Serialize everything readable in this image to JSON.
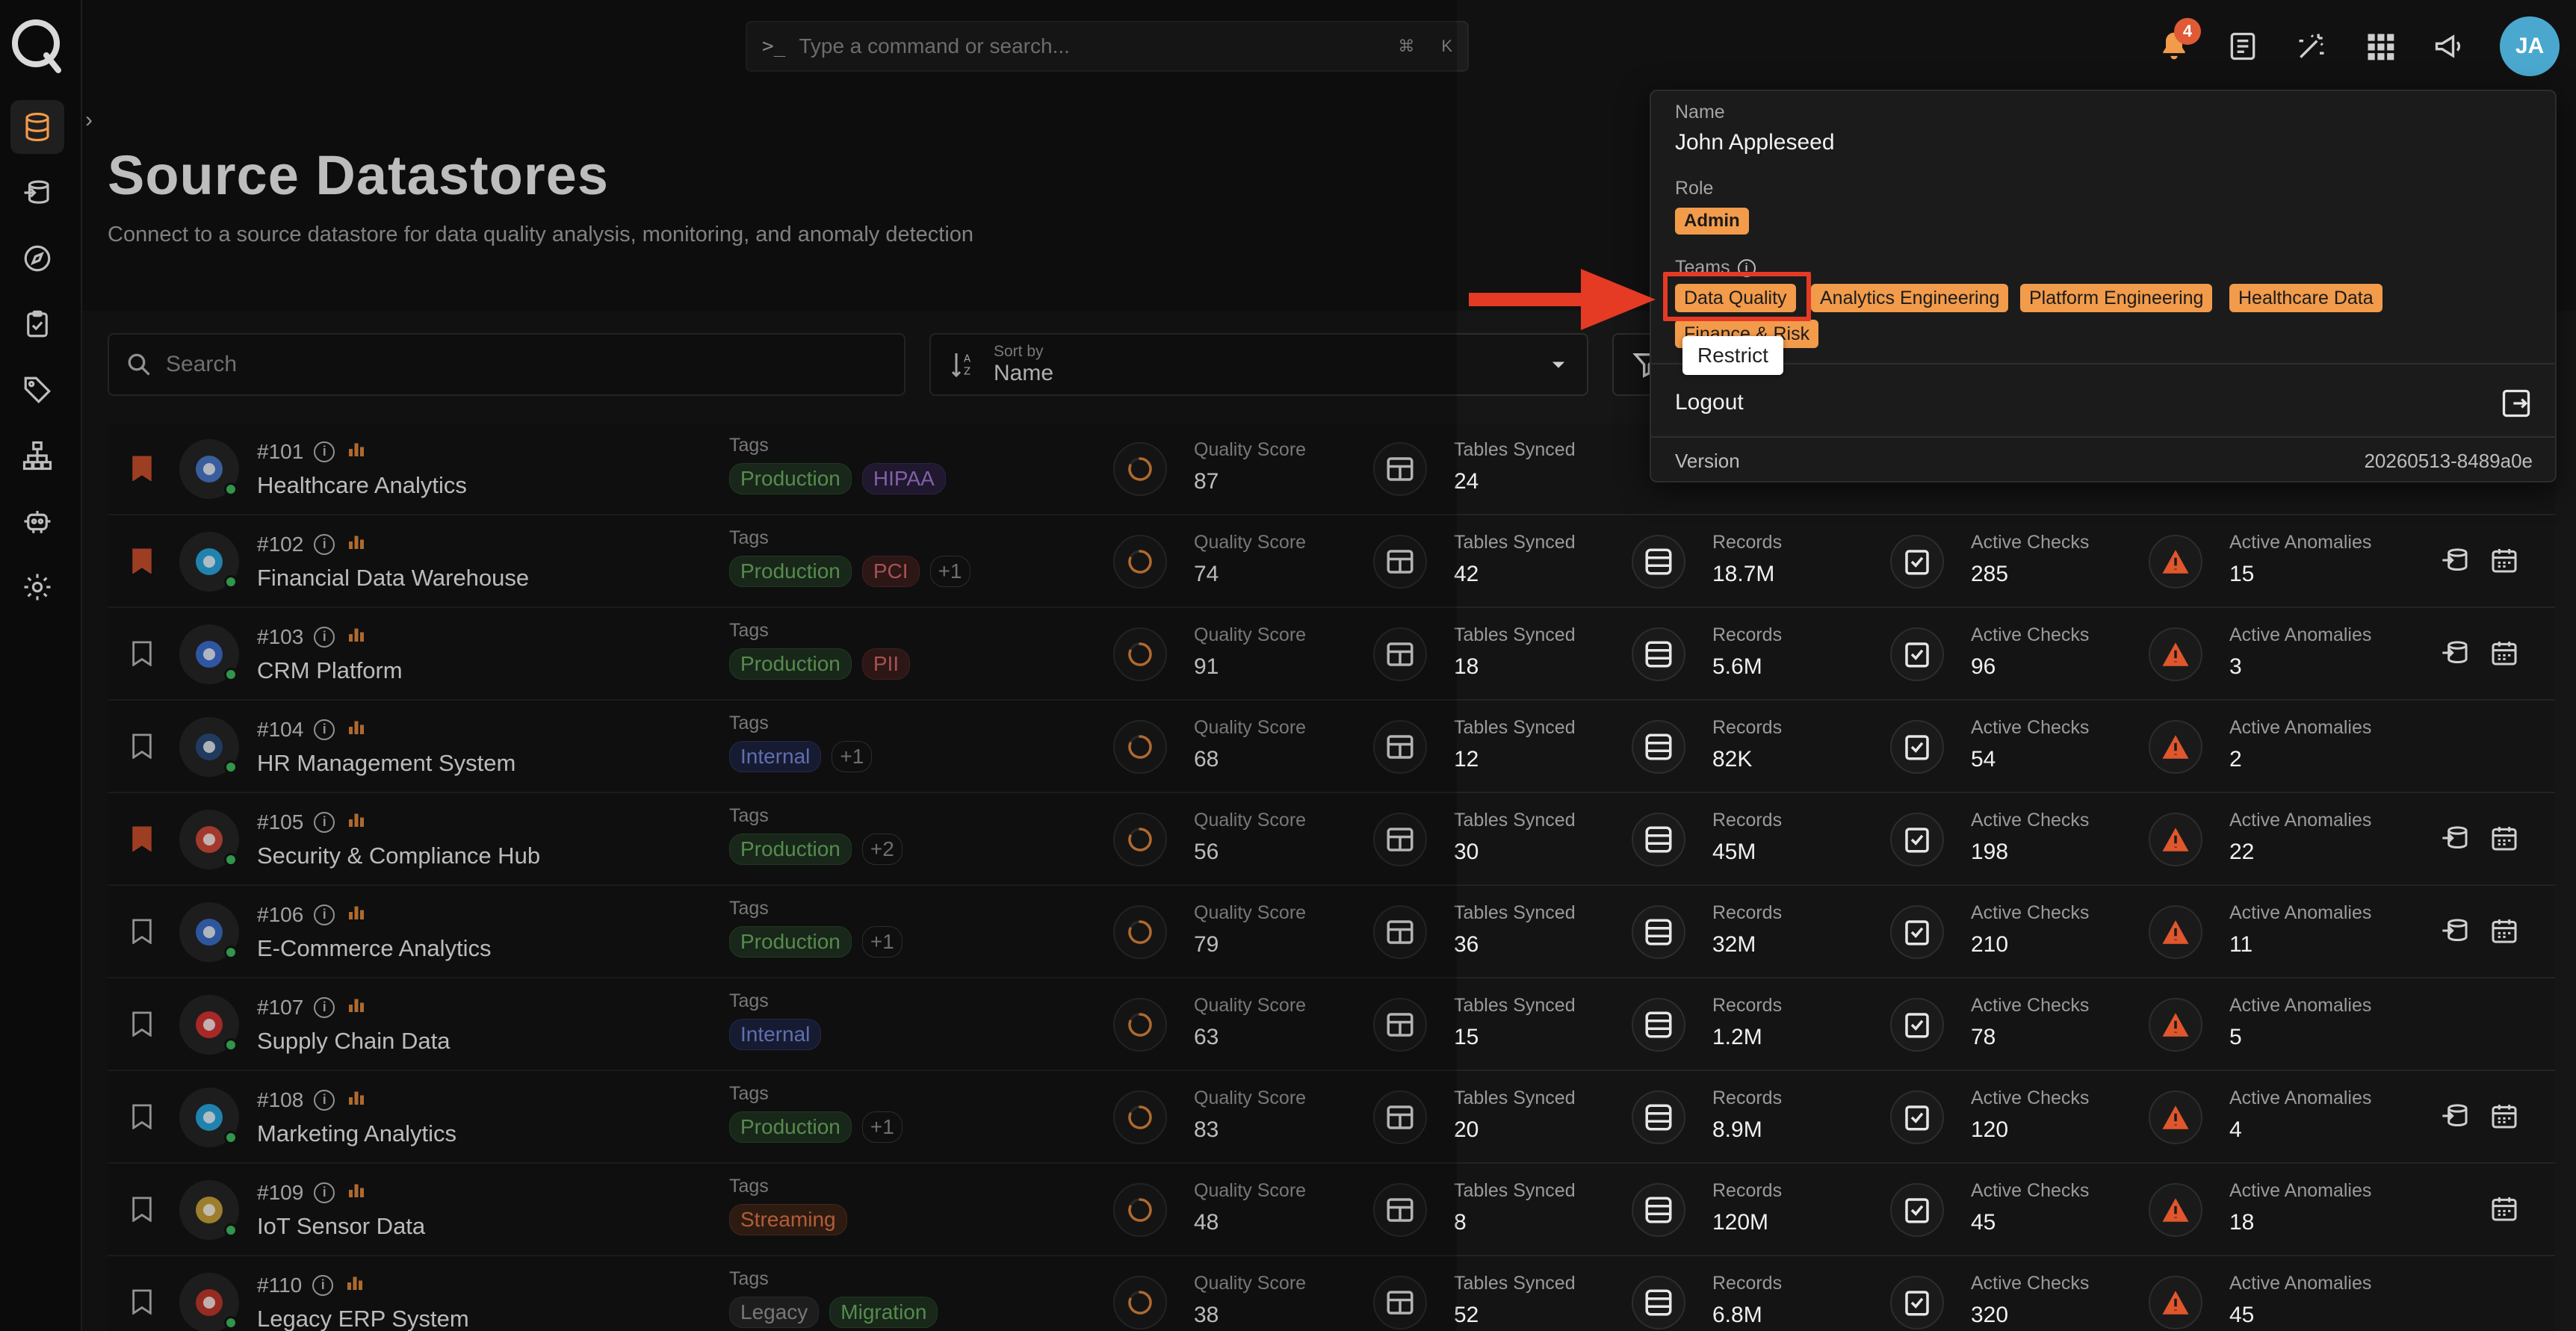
{
  "command_bar": {
    "placeholder": "Type a command or search...",
    "shortcut_mod": "⌘",
    "shortcut_key": "K"
  },
  "notifications": {
    "count": "4"
  },
  "user": {
    "initials": "JA"
  },
  "page": {
    "title": "Source Datastores",
    "subtitle": "Connect to a source datastore for data quality analysis, monitoring, and anomaly detection"
  },
  "search": {
    "placeholder": "Search"
  },
  "sort": {
    "label": "Sort by",
    "value": "Name"
  },
  "labels": {
    "tags": "Tags",
    "quality_score": "Quality Score",
    "tables_synced": "Tables Synced",
    "records": "Records",
    "active_checks": "Active Checks",
    "active_anomalies": "Active Anomalies"
  },
  "datastores": [
    {
      "id": "#101",
      "name": "Healthcare Analytics",
      "bookmarked": true,
      "tags": [
        {
          "t": "Production",
          "k": "production"
        },
        {
          "t": "HIPAA",
          "k": "hipaa"
        }
      ],
      "quality": "87",
      "tables": "24",
      "records": "",
      "checks": "",
      "anomalies": "",
      "actions": []
    },
    {
      "id": "#102",
      "name": "Financial Data Warehouse",
      "bookmarked": true,
      "tags": [
        {
          "t": "Production",
          "k": "production"
        },
        {
          "t": "PCI",
          "k": "pci"
        },
        {
          "t": "+1",
          "k": "more"
        }
      ],
      "quality": "74",
      "tables": "42",
      "records": "18.7M",
      "checks": "285",
      "anomalies": "15",
      "actions": [
        "sync",
        "calendar"
      ]
    },
    {
      "id": "#103",
      "name": "CRM Platform",
      "bookmarked": false,
      "tags": [
        {
          "t": "Production",
          "k": "production"
        },
        {
          "t": "PII",
          "k": "pii"
        }
      ],
      "quality": "91",
      "tables": "18",
      "records": "5.6M",
      "checks": "96",
      "anomalies": "3",
      "actions": [
        "sync",
        "calendar"
      ]
    },
    {
      "id": "#104",
      "name": "HR Management System",
      "bookmarked": false,
      "tags": [
        {
          "t": "Internal",
          "k": "internal"
        },
        {
          "t": "+1",
          "k": "more"
        }
      ],
      "quality": "68",
      "tables": "12",
      "records": "82K",
      "checks": "54",
      "anomalies": "2",
      "actions": []
    },
    {
      "id": "#105",
      "name": "Security & Compliance Hub",
      "bookmarked": true,
      "tags": [
        {
          "t": "Production",
          "k": "production"
        },
        {
          "t": "+2",
          "k": "more"
        }
      ],
      "quality": "56",
      "tables": "30",
      "records": "45M",
      "checks": "198",
      "anomalies": "22",
      "actions": [
        "sync",
        "calendar"
      ]
    },
    {
      "id": "#106",
      "name": "E-Commerce Analytics",
      "bookmarked": false,
      "tags": [
        {
          "t": "Production",
          "k": "production"
        },
        {
          "t": "+1",
          "k": "more"
        }
      ],
      "quality": "79",
      "tables": "36",
      "records": "32M",
      "checks": "210",
      "anomalies": "11",
      "actions": [
        "sync",
        "calendar"
      ]
    },
    {
      "id": "#107",
      "name": "Supply Chain Data",
      "bookmarked": false,
      "tags": [
        {
          "t": "Internal",
          "k": "internal"
        }
      ],
      "quality": "63",
      "tables": "15",
      "records": "1.2M",
      "checks": "78",
      "anomalies": "5",
      "actions": []
    },
    {
      "id": "#108",
      "name": "Marketing Analytics",
      "bookmarked": false,
      "tags": [
        {
          "t": "Production",
          "k": "production"
        },
        {
          "t": "+1",
          "k": "more"
        }
      ],
      "quality": "83",
      "tables": "20",
      "records": "8.9M",
      "checks": "120",
      "anomalies": "4",
      "actions": [
        "sync",
        "calendar"
      ]
    },
    {
      "id": "#109",
      "name": "IoT Sensor Data",
      "bookmarked": false,
      "tags": [
        {
          "t": "Streaming",
          "k": "streaming"
        }
      ],
      "quality": "48",
      "tables": "8",
      "records": "120M",
      "checks": "45",
      "anomalies": "18",
      "actions": [
        "calendar"
      ]
    },
    {
      "id": "#110",
      "name": "Legacy ERP System",
      "bookmarked": false,
      "tags": [
        {
          "t": "Legacy",
          "k": "legacy"
        },
        {
          "t": "Migration",
          "k": "migration"
        }
      ],
      "quality": "38",
      "tables": "52",
      "records": "6.8M",
      "checks": "320",
      "anomalies": "45",
      "actions": []
    }
  ],
  "profile": {
    "name_label": "Name",
    "name": "John Appleseed",
    "role_label": "Role",
    "role": "Admin",
    "teams_label": "Teams",
    "teams": [
      "Data Quality",
      "Analytics Engineering",
      "Platform Engineering",
      "Healthcare Data",
      "Finance & Risk"
    ],
    "tooltip": "Restrict",
    "logout": "Logout",
    "version_label": "Version",
    "version": "20260513-8489a0e"
  },
  "colors": {
    "accent": "#f29b4a",
    "highlight": "#e53a24",
    "bookmark": "#c9502e"
  }
}
